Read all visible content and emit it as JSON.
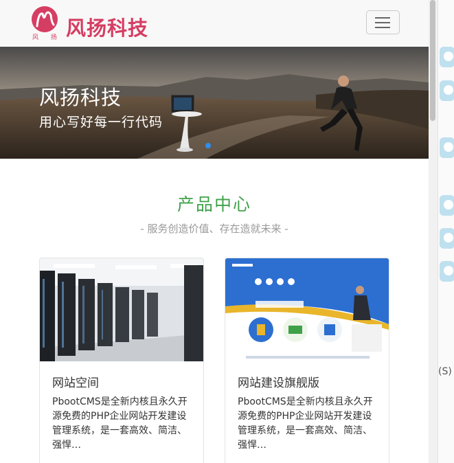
{
  "header": {
    "brand": "风扬科技",
    "logo_caption": "风 扬",
    "menu_icon": "hamburger-icon"
  },
  "banner": {
    "title": "风扬科技",
    "subtitle": "用心写好每一行代码"
  },
  "section": {
    "title": "产品中心",
    "subtitle": "- 服务创造价值、存在造就未来 -"
  },
  "cards": [
    {
      "title": "网站空间",
      "desc": "PbootCMS是全新内核且永久开源免费的PHP企业网站开发建设管理系统，是一套高效、简洁、强悍…"
    },
    {
      "title": "网站建设旗舰版",
      "desc": "PbootCMS是全新内核且永久开源免费的PHP企业网站开发建设管理系统，是一套高效、简洁、强悍…"
    }
  ],
  "side": {
    "label": "(S)"
  },
  "colors": {
    "brand": "#d63d62",
    "section_title": "#3fa14a",
    "active_dot": "#2f8ef0"
  }
}
